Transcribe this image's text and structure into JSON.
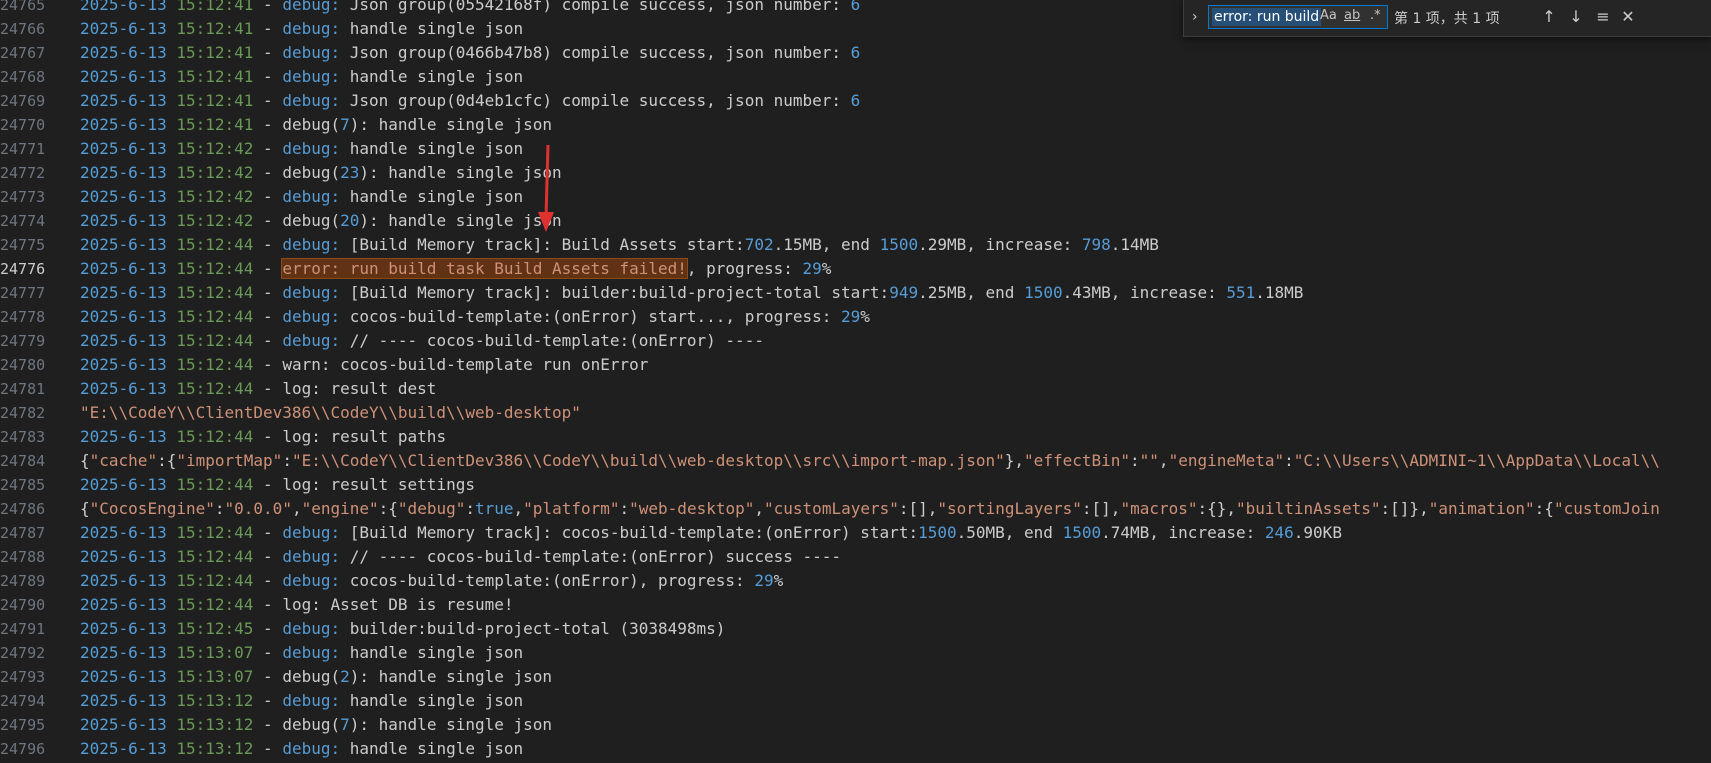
{
  "colors": {
    "background": "#1f1f1f",
    "date": "#569cd6",
    "time": "#6a9955",
    "keyword": "#569cd6",
    "string": "#ce9178",
    "highlight": "#613214",
    "annotation_arrow": "#e03131"
  },
  "find": {
    "query": "error: run build",
    "match_case_label": "Aa",
    "whole_word_label": "ab",
    "regex_label": ".*",
    "result_count": "第 1 项，共 1 项",
    "toggle_icon": "chevron-right-icon",
    "prev_icon": "arrow-up-icon",
    "next_icon": "arrow-down-icon",
    "selection_icon": "find-in-selection-icon",
    "close_icon": "close-icon"
  },
  "current_line": "24776",
  "lines": [
    {
      "n": "24765",
      "date": "2025-6-13",
      "time": "15:12:41",
      "level": "debug:",
      "text": " Json group(05542168f) compile success, json number: ",
      "num": "6"
    },
    {
      "n": "24766",
      "date": "2025-6-13",
      "time": "15:12:41",
      "level": "debug:",
      "text": " handle single json"
    },
    {
      "n": "24767",
      "date": "2025-6-13",
      "time": "15:12:41",
      "level": "debug:",
      "text": " Json group(0466b47b8) compile success, json number: ",
      "num": "6"
    },
    {
      "n": "24768",
      "date": "2025-6-13",
      "time": "15:12:41",
      "level": "debug:",
      "text": " handle single json"
    },
    {
      "n": "24769",
      "date": "2025-6-13",
      "time": "15:12:41",
      "level": "debug:",
      "text": " Json group(0d4eb1cfc) compile success, json number: ",
      "num": "6"
    },
    {
      "n": "24770",
      "date": "2025-6-13",
      "time": "15:12:41",
      "pre": "debug(",
      "pnum": "7",
      "post": "): handle single json"
    },
    {
      "n": "24771",
      "date": "2025-6-13",
      "time": "15:12:42",
      "level": "debug:",
      "text": " handle single json"
    },
    {
      "n": "24772",
      "date": "2025-6-13",
      "time": "15:12:42",
      "pre": "debug(",
      "pnum": "23",
      "post": "): handle single json"
    },
    {
      "n": "24773",
      "date": "2025-6-13",
      "time": "15:12:42",
      "level": "debug:",
      "text": " handle single json"
    },
    {
      "n": "24774",
      "date": "2025-6-13",
      "time": "15:12:42",
      "pre": "debug(",
      "pnum": "20",
      "post": "): handle single json"
    },
    {
      "n": "24775",
      "date": "2025-6-13",
      "time": "15:12:44",
      "level": "debug:",
      "segs": [
        " [Build Memory track]: Build Assets start:",
        {
          "num": "702"
        },
        ".15MB, end ",
        {
          "num": "1500"
        },
        ".29MB, increase: ",
        {
          "num": "798"
        },
        ".14MB"
      ]
    },
    {
      "n": "24776",
      "date": "2025-6-13",
      "time": "15:12:44",
      "error": "error: run build task Build Assets failed!",
      "segs": [
        ", progress: ",
        {
          "num": "29"
        },
        "%"
      ]
    },
    {
      "n": "24777",
      "date": "2025-6-13",
      "time": "15:12:44",
      "level": "debug:",
      "segs": [
        " [Build Memory track]: builder:build-project-total start:",
        {
          "num": "949"
        },
        ".25MB, end ",
        {
          "num": "1500"
        },
        ".43MB, increase: ",
        {
          "num": "551"
        },
        ".18MB"
      ]
    },
    {
      "n": "24778",
      "date": "2025-6-13",
      "time": "15:12:44",
      "level": "debug:",
      "segs": [
        " cocos-build-template:(onError) start..., progress: ",
        {
          "num": "29"
        },
        "%"
      ]
    },
    {
      "n": "24779",
      "date": "2025-6-13",
      "time": "15:12:44",
      "level": "debug:",
      "text": " // ---- cocos-build-template:(onError) ----"
    },
    {
      "n": "24780",
      "date": "2025-6-13",
      "time": "15:12:44",
      "plain": "warn: cocos-build-template run onError"
    },
    {
      "n": "24781",
      "date": "2025-6-13",
      "time": "15:12:44",
      "plain": "log: result dest"
    },
    {
      "n": "24782",
      "raw_str": "\"E:\\\\CodeY\\\\ClientDev386\\\\CodeY\\\\build\\\\web-desktop\""
    },
    {
      "n": "24783",
      "date": "2025-6-13",
      "time": "15:12:44",
      "plain": "log: result paths"
    },
    {
      "n": "24784",
      "json": [
        [
          "p",
          "{"
        ],
        [
          "s",
          "\"cache\""
        ],
        [
          "p",
          ":{"
        ],
        [
          "s",
          "\"importMap\""
        ],
        [
          "p",
          ":"
        ],
        [
          "s",
          "\"E:\\\\CodeY\\\\ClientDev386\\\\CodeY\\\\build\\\\web-desktop\\\\src\\\\import-map.json\""
        ],
        [
          "p",
          "},"
        ],
        [
          "s",
          "\"effectBin\""
        ],
        [
          "p",
          ":"
        ],
        [
          "s",
          "\"\""
        ],
        [
          "p",
          ","
        ],
        [
          "s",
          "\"engineMeta\""
        ],
        [
          "p",
          ":"
        ],
        [
          "s",
          "\"C:\\\\Users\\\\ADMINI~1\\\\AppData\\\\Local\\\\"
        ]
      ]
    },
    {
      "n": "24785",
      "date": "2025-6-13",
      "time": "15:12:44",
      "plain": "log: result settings"
    },
    {
      "n": "24786",
      "json": [
        [
          "p",
          "{"
        ],
        [
          "s",
          "\"CocosEngine\""
        ],
        [
          "p",
          ":"
        ],
        [
          "s",
          "\"0.0.0\""
        ],
        [
          "p",
          ","
        ],
        [
          "s",
          "\"engine\""
        ],
        [
          "p",
          ":{"
        ],
        [
          "s",
          "\"debug\""
        ],
        [
          "p",
          ":"
        ],
        [
          "b",
          "true"
        ],
        [
          "p",
          ","
        ],
        [
          "s",
          "\"platform\""
        ],
        [
          "p",
          ":"
        ],
        [
          "s",
          "\"web-desktop\""
        ],
        [
          "p",
          ","
        ],
        [
          "s",
          "\"customLayers\""
        ],
        [
          "p",
          ":[],"
        ],
        [
          "s",
          "\"sortingLayers\""
        ],
        [
          "p",
          ":[],"
        ],
        [
          "s",
          "\"macros\""
        ],
        [
          "p",
          ":{},"
        ],
        [
          "s",
          "\"builtinAssets\""
        ],
        [
          "p",
          ":[]},"
        ],
        [
          "s",
          "\"animation\""
        ],
        [
          "p",
          ":{"
        ],
        [
          "s",
          "\"customJoin"
        ]
      ]
    },
    {
      "n": "24787",
      "date": "2025-6-13",
      "time": "15:12:44",
      "level": "debug:",
      "segs": [
        " [Build Memory track]: cocos-build-template:(onError) start:",
        {
          "num": "1500"
        },
        ".50MB, end ",
        {
          "num": "1500"
        },
        ".74MB, increase: ",
        {
          "num": "246"
        },
        ".90KB"
      ]
    },
    {
      "n": "24788",
      "date": "2025-6-13",
      "time": "15:12:44",
      "level": "debug:",
      "text": " // ---- cocos-build-template:(onError) success ----"
    },
    {
      "n": "24789",
      "date": "2025-6-13",
      "time": "15:12:44",
      "level": "debug:",
      "segs": [
        " cocos-build-template:(onError), progress: ",
        {
          "num": "29"
        },
        "%"
      ]
    },
    {
      "n": "24790",
      "date": "2025-6-13",
      "time": "15:12:44",
      "plain": "log: Asset DB is resume!"
    },
    {
      "n": "24791",
      "date": "2025-6-13",
      "time": "15:12:45",
      "level": "debug:",
      "text": " builder:build-project-total (3038498ms)"
    },
    {
      "n": "24792",
      "date": "2025-6-13",
      "time": "15:13:07",
      "level": "debug:",
      "text": " handle single json"
    },
    {
      "n": "24793",
      "date": "2025-6-13",
      "time": "15:13:07",
      "pre": "debug(",
      "pnum": "2",
      "post": "): handle single json"
    },
    {
      "n": "24794",
      "date": "2025-6-13",
      "time": "15:13:12",
      "level": "debug:",
      "text": " handle single json"
    },
    {
      "n": "24795",
      "date": "2025-6-13",
      "time": "15:13:12",
      "pre": "debug(",
      "pnum": "7",
      "post": "): handle single json"
    },
    {
      "n": "24796",
      "date": "2025-6-13",
      "time": "15:13:12",
      "level": "debug:",
      "text": " handle single json"
    }
  ]
}
